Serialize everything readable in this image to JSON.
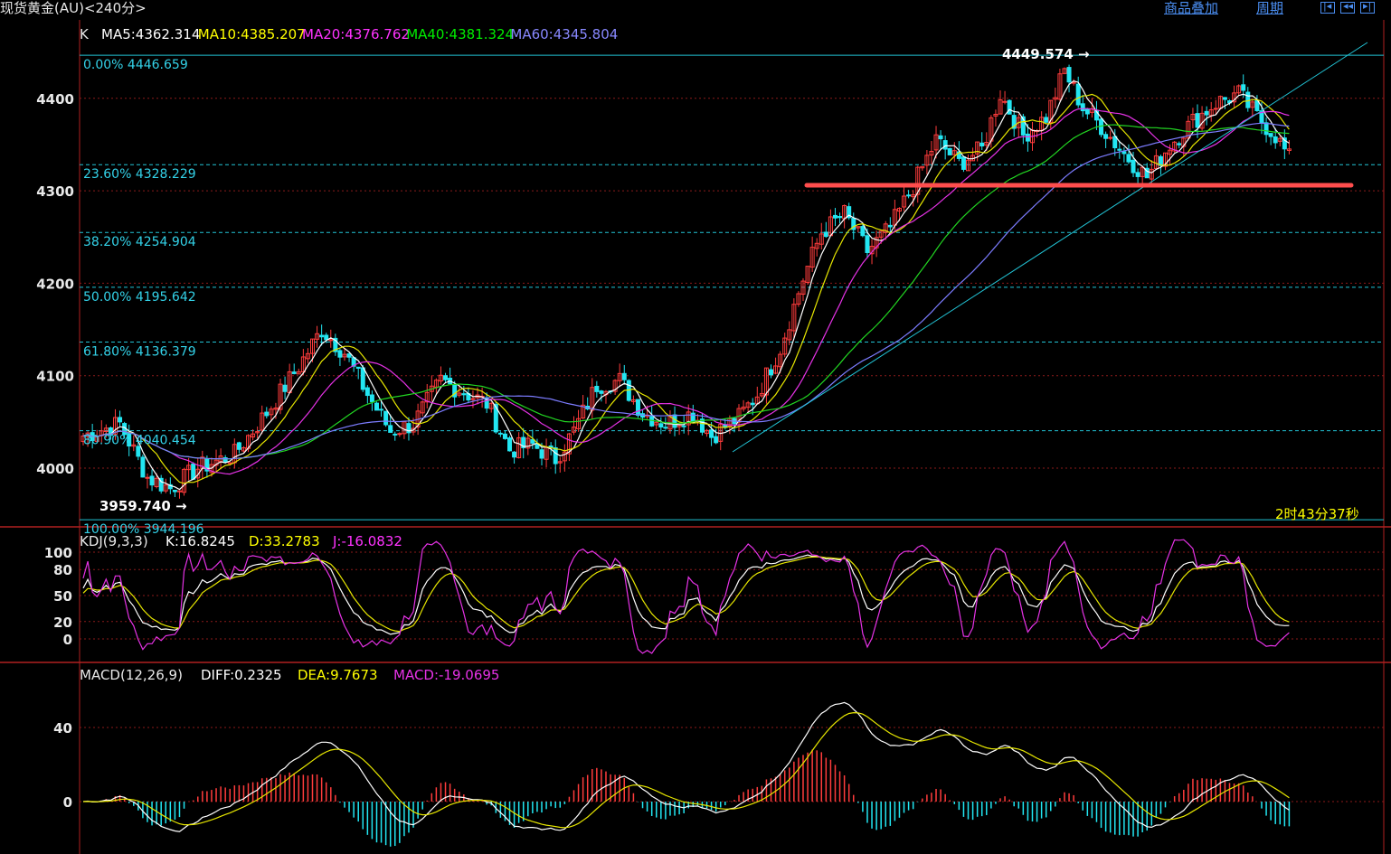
{
  "title": "现货黄金(AU)<240分>",
  "links": {
    "overlay": "商品叠加",
    "period": "周期"
  },
  "nav_icons": [
    "page-first-icon",
    "page-prev-icon",
    "page-next-icon"
  ],
  "main": {
    "label": "K",
    "ma": [
      {
        "label": "MA5:4362.314",
        "color": "#ffffff"
      },
      {
        "label": "MA10:4385.207",
        "color": "#ffff00"
      },
      {
        "label": "MA20:4376.762",
        "color": "#ff33ff"
      },
      {
        "label": "MA40:4381.324",
        "color": "#00ee00"
      },
      {
        "label": "MA60:4345.804",
        "color": "#8888ff"
      }
    ],
    "y_ticks": [
      "4400",
      "4300",
      "4200",
      "4100",
      "4000"
    ],
    "fib": [
      {
        "label": "0.00% 4446.659",
        "value": 4446.659
      },
      {
        "label": "23.60% 4328.229",
        "value": 4328.229
      },
      {
        "label": "38.20% 4254.904",
        "value": 4254.904
      },
      {
        "label": "50.00% 4195.642",
        "value": 4195.642
      },
      {
        "label": "61.80% 4136.379",
        "value": 4136.379
      },
      {
        "label": "80.90% 4040.454",
        "value": 4040.454
      },
      {
        "label": "100.00% 3944.196",
        "value": 3944.196
      }
    ],
    "high_label": "4449.574",
    "low_label": "3959.740",
    "support_level": 4306,
    "countdown": "2时43分37秒"
  },
  "kdj": {
    "label": "KDJ(9,3,3)",
    "k": "K:16.8245",
    "d": "D:33.2783",
    "j": "J:-16.0832",
    "y_ticks": [
      "100",
      "80",
      "50",
      "20",
      "0"
    ]
  },
  "macd": {
    "label": "MACD(12,26,9)",
    "diff": "DIFF:0.2325",
    "dea": "DEA:9.7673",
    "macd": "MACD:-19.0695",
    "y_ticks": [
      "40",
      "0"
    ]
  },
  "chart_data": [
    {
      "type": "candlestick",
      "title": "现货黄金(AU)<240分>",
      "xlabel": "",
      "ylabel": "",
      "ylim": [
        3944,
        4455
      ],
      "grid": true,
      "close_anchors": [
        [
          0,
          4035
        ],
        [
          8,
          4048
        ],
        [
          14,
          3990
        ],
        [
          19,
          3978
        ],
        [
          25,
          4000
        ],
        [
          33,
          4015
        ],
        [
          40,
          4060
        ],
        [
          47,
          4110
        ],
        [
          52,
          4150
        ],
        [
          57,
          4125
        ],
        [
          62,
          4080
        ],
        [
          67,
          4040
        ],
        [
          72,
          4048
        ],
        [
          78,
          4095
        ],
        [
          82,
          4085
        ],
        [
          88,
          4070
        ],
        [
          93,
          4020
        ],
        [
          98,
          4025
        ],
        [
          103,
          4010
        ],
        [
          107,
          4040
        ],
        [
          112,
          4090
        ],
        [
          117,
          4095
        ],
        [
          122,
          4060
        ],
        [
          127,
          4048
        ],
        [
          133,
          4060
        ],
        [
          137,
          4035
        ],
        [
          143,
          4055
        ],
        [
          147,
          4080
        ],
        [
          152,
          4130
        ],
        [
          157,
          4205
        ],
        [
          161,
          4255
        ],
        [
          166,
          4275
        ],
        [
          171,
          4235
        ],
        [
          176,
          4260
        ],
        [
          181,
          4305
        ],
        [
          186,
          4355
        ],
        [
          191,
          4330
        ],
        [
          196,
          4345
        ],
        [
          200,
          4405
        ],
        [
          205,
          4360
        ],
        [
          210,
          4380
        ],
        [
          214,
          4430
        ],
        [
          218,
          4390
        ],
        [
          222,
          4370
        ],
        [
          227,
          4340
        ],
        [
          232,
          4315
        ],
        [
          237,
          4350
        ],
        [
          242,
          4375
        ],
        [
          247,
          4395
        ],
        [
          252,
          4405
        ],
        [
          256,
          4380
        ],
        [
          260,
          4360
        ],
        [
          263,
          4335
        ]
      ],
      "annotations": [
        "4449.574",
        "3959.740",
        "2时43分37秒"
      ]
    },
    {
      "type": "line",
      "title": "KDJ(9,3,3)",
      "ylim": [
        -20,
        110
      ],
      "series_values_last": {
        "K": 16.8245,
        "D": 33.2783,
        "J": -16.0832
      }
    },
    {
      "type": "line",
      "title": "MACD(12,26,9)",
      "ylim": [
        -40,
        85
      ],
      "series_values_last": {
        "DIFF": 0.2325,
        "DEA": 9.7673,
        "MACD": -19.0695
      }
    }
  ]
}
